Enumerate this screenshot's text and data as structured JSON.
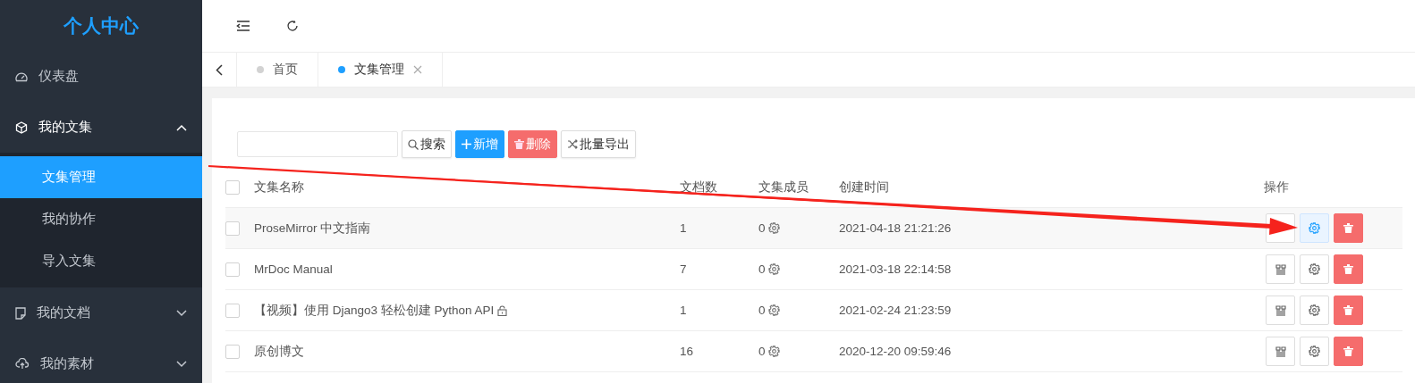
{
  "sidebar": {
    "title": "个人中心",
    "items": [
      {
        "label": "仪表盘"
      },
      {
        "label": "我的文集",
        "expanded": true,
        "children": [
          {
            "label": "文集管理",
            "selected": true
          },
          {
            "label": "我的协作",
            "selected": false
          },
          {
            "label": "导入文集",
            "selected": false
          }
        ]
      },
      {
        "label": "我的文档",
        "expanded": false
      },
      {
        "label": "我的素材",
        "expanded": false
      }
    ]
  },
  "tabs": [
    {
      "label": "首页",
      "selected": false
    },
    {
      "label": "文集管理",
      "selected": true
    }
  ],
  "toolbar": {
    "buttons": [
      {
        "label": "搜索",
        "kind": "search"
      },
      {
        "label": "新增",
        "kind": "primary"
      },
      {
        "label": "删除",
        "kind": "danger"
      },
      {
        "label": "批量导出",
        "kind": "export"
      }
    ]
  },
  "table": {
    "select_all_checked": false,
    "columns": [
      "文集名称",
      "文档数",
      "文集成员",
      "创建时间",
      "操作"
    ],
    "rows": [
      {
        "checked": false,
        "name": "ProseMirror 中文指南",
        "locked": false,
        "docs": "1",
        "members": "0",
        "created": "2021-04-18 21:21:26",
        "hovered": true
      },
      {
        "checked": false,
        "name": "MrDoc Manual",
        "locked": false,
        "docs": "7",
        "members": "0",
        "created": "2021-03-18 22:14:58",
        "hovered": false
      },
      {
        "checked": false,
        "name": "【视频】使用 Django3 轻松创建 Python API",
        "locked": true,
        "docs": "1",
        "members": "0",
        "created": "2021-02-24 21:23:59",
        "hovered": false
      },
      {
        "checked": false,
        "name": "原创博文",
        "locked": false,
        "docs": "16",
        "members": "0",
        "created": "2020-12-20 09:59:46",
        "hovered": false
      }
    ]
  }
}
